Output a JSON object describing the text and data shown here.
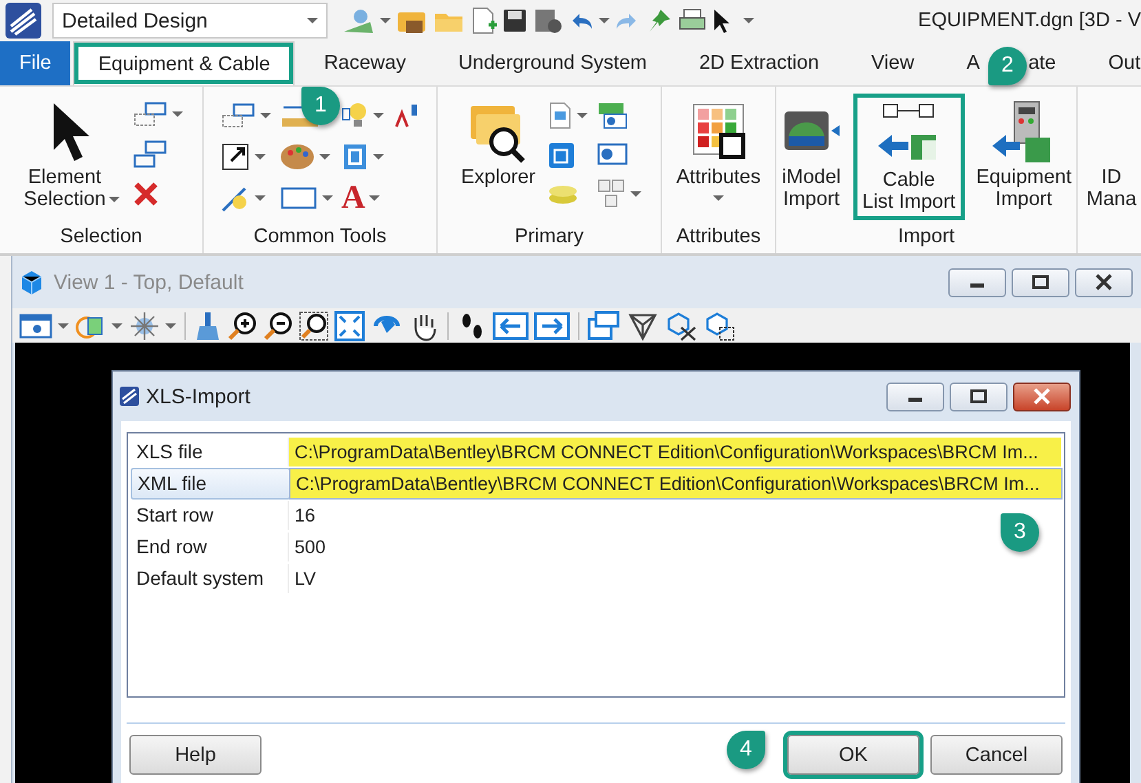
{
  "app": {
    "workflow": "Detailed Design",
    "title": "EQUIPMENT.dgn [3D - V"
  },
  "tabs": [
    {
      "label": "File",
      "kind": "file",
      "selected": false,
      "highlighted": false
    },
    {
      "label": "Equipment & Cable",
      "kind": "tab",
      "selected": true,
      "highlighted": true
    },
    {
      "label": "Raceway",
      "kind": "tab",
      "selected": false,
      "highlighted": false
    },
    {
      "label": "Underground System",
      "kind": "tab",
      "selected": false,
      "highlighted": false
    },
    {
      "label": "2D Extraction",
      "kind": "tab",
      "selected": false,
      "highlighted": false
    },
    {
      "label": "View",
      "kind": "tab",
      "selected": false,
      "highlighted": false
    },
    {
      "label": "A ate",
      "kind": "covered",
      "selected": false,
      "highlighted": false
    },
    {
      "label": "Out",
      "kind": "tab",
      "selected": false,
      "highlighted": false
    }
  ],
  "ribbon": [
    {
      "label": "Selection",
      "kind": "selection",
      "buttons": [
        {
          "lines": [
            "Element",
            "Selection"
          ],
          "dropdown": true,
          "highlighted": false
        }
      ]
    },
    {
      "label": "Common Tools",
      "kind": "common",
      "glyph": "A"
    },
    {
      "label": "Primary",
      "kind": "primary",
      "buttons": [
        {
          "lines": [
            "Explorer"
          ],
          "dropdown": false,
          "highlighted": false
        }
      ]
    },
    {
      "label": "Attributes",
      "kind": "attributes",
      "buttons": [
        {
          "lines": [
            "Attributes"
          ],
          "dropdown": true,
          "highlighted": false
        }
      ]
    },
    {
      "label": "Import",
      "kind": "import",
      "buttons": [
        {
          "lines": [
            "iModel",
            "Import"
          ],
          "dropdown": false,
          "highlighted": false
        },
        {
          "lines": [
            "Cable",
            "List Import"
          ],
          "dropdown": false,
          "highlighted": true
        },
        {
          "lines": [
            "Equipment",
            "Import"
          ],
          "dropdown": false,
          "highlighted": false
        }
      ]
    },
    {
      "kind": "id",
      "buttons": [
        {
          "lines": [
            "ID",
            "Mana"
          ],
          "dropdown": false,
          "highlighted": false
        }
      ]
    }
  ],
  "view": {
    "title": "View 1 - Top, Default"
  },
  "dialog": {
    "title": "XLS-Import",
    "properties": [
      {
        "label": "XLS file",
        "value": "C:\\ProgramData\\Bentley\\BRCM CONNECT Edition\\Configuration\\Workspaces\\BRCM Im...",
        "highlighted": true,
        "selected": false
      },
      {
        "label": "XML file",
        "value": "C:\\ProgramData\\Bentley\\BRCM CONNECT Edition\\Configuration\\Workspaces\\BRCM Im...",
        "highlighted": true,
        "selected": true
      },
      {
        "label": "Start row",
        "value": "16",
        "highlighted": false,
        "selected": false
      },
      {
        "label": "End row",
        "value": "500",
        "highlighted": false,
        "selected": false
      },
      {
        "label": "Default system",
        "value": "LV",
        "highlighted": false,
        "selected": false
      }
    ],
    "buttons": [
      {
        "label": "Help",
        "kind": "left",
        "highlighted": false
      },
      {
        "label": "OK",
        "kind": "right",
        "highlighted": true
      },
      {
        "label": "Cancel",
        "kind": "right",
        "highlighted": false
      }
    ]
  },
  "callouts": [
    {
      "label": "1",
      "kind": "tab"
    },
    {
      "label": "2",
      "kind": "ribbon"
    },
    {
      "label": "3",
      "kind": "grid"
    },
    {
      "label": "4",
      "kind": "ok"
    }
  ]
}
